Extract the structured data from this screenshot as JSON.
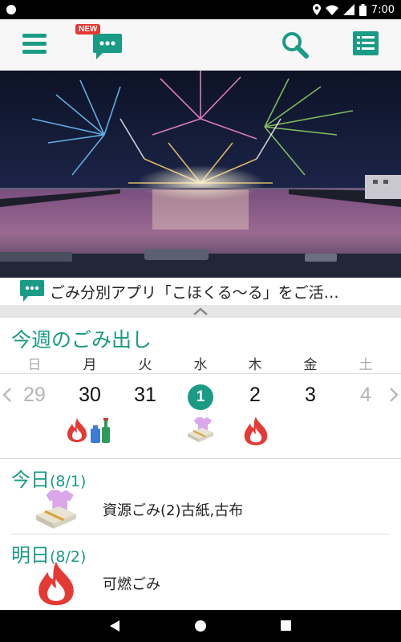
{
  "status_bar": {
    "time": "7:00"
  },
  "app_bar": {
    "new_badge": "NEW"
  },
  "news": {
    "text": "ごみ分別アプリ「こほくる〜る」をご活…"
  },
  "week": {
    "title": "今週のごみ出し",
    "days_of_week": [
      "日",
      "月",
      "火",
      "水",
      "木",
      "金",
      "土"
    ],
    "dates": [
      "29",
      "30",
      "31",
      "1",
      "2",
      "3",
      "4"
    ],
    "today_index": 3,
    "icons": [
      {
        "day": "30",
        "items": [
          "fire-icon",
          "bottles-icon"
        ]
      },
      {
        "day": "1",
        "items": [
          "paper-cloth-icon"
        ]
      },
      {
        "day": "2",
        "items": [
          "fire-icon"
        ]
      }
    ]
  },
  "today": {
    "label": "今日",
    "date": "(8/1)",
    "type": "資源ごみ(2)古紙,古布",
    "icon": "paper-cloth-icon"
  },
  "tomorrow": {
    "label": "明日",
    "date": "(8/2)",
    "type": "可燃ごみ",
    "icon": "fire-icon"
  },
  "colors": {
    "accent": "#1a9b85",
    "fire": "#e53935"
  }
}
